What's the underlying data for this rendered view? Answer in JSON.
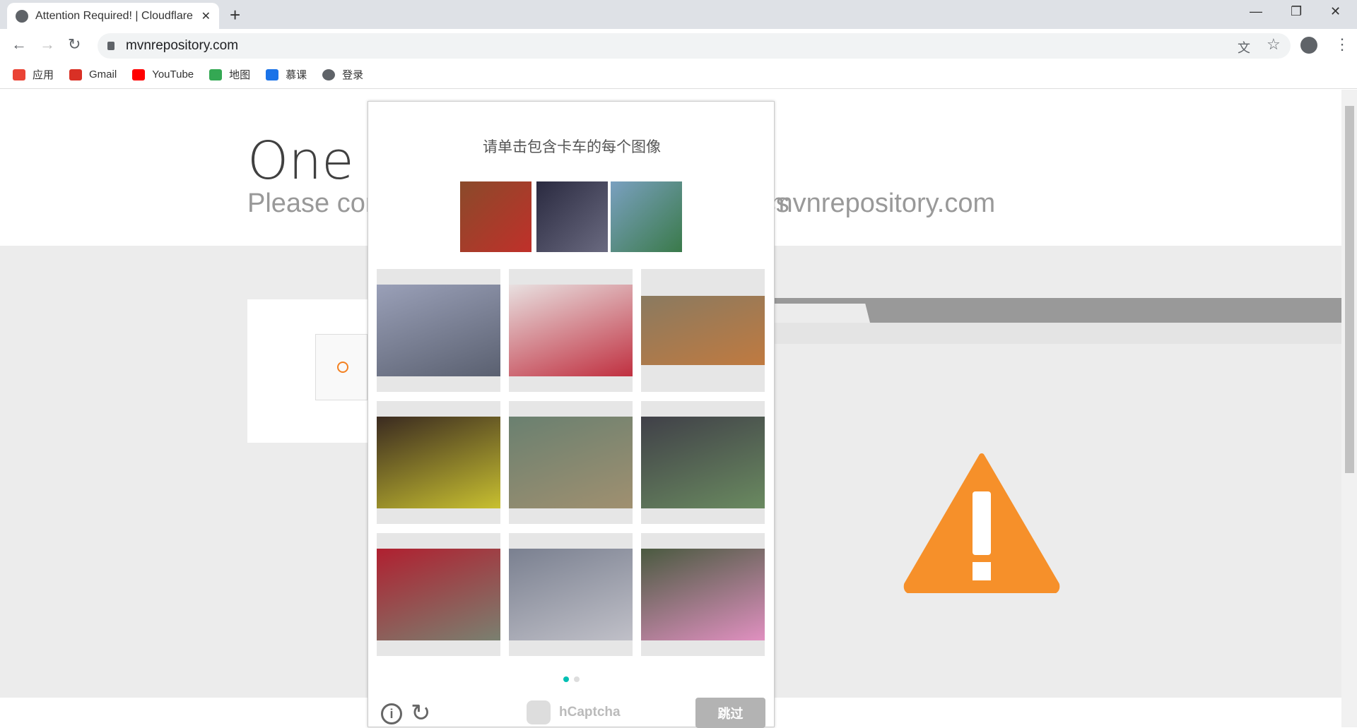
{
  "browser": {
    "tab_title": "Attention Required! | Cloudflare",
    "url": "mvnrepository.com",
    "bookmarks": [
      {
        "label": "应用",
        "color": "#ea4335"
      },
      {
        "label": "Gmail",
        "color": "#d93025"
      },
      {
        "label": "YouTube",
        "color": "#ff0000"
      },
      {
        "label": "地图",
        "color": "#34a853"
      },
      {
        "label": "慕课",
        "color": "#1a73e8"
      },
      {
        "label": "登录",
        "color": "#5f6368"
      }
    ]
  },
  "page": {
    "heading": "One more step",
    "subheading": "Please complete the security check to access",
    "domain": "mvnrepository.com",
    "accent": "#f6902a"
  },
  "captcha": {
    "prompt": "请单击包含卡车的每个图像",
    "brand": "hCaptcha",
    "skip_label": "跳过",
    "page": 1,
    "pages": 2,
    "samples": [
      {
        "name": "fire-truck",
        "c1": "#8a4a2a",
        "c2": "#c0302a"
      },
      {
        "name": "truck-cab",
        "c1": "#2a2a40",
        "c2": "#6a6a80"
      },
      {
        "name": "garbage-truck",
        "c1": "#7aa0c0",
        "c2": "#3a7a4a"
      }
    ],
    "tiles": [
      {
        "name": "truck",
        "c1": "#9aa0b8",
        "c2": "#5a6070"
      },
      {
        "name": "scooters",
        "c1": "#e8e0e0",
        "c2": "#c03040"
      },
      {
        "name": "train",
        "c1": "#8a7a60",
        "c2": "#c07a40"
      },
      {
        "name": "motorbike",
        "c1": "#3a2a20",
        "c2": "#c8c030"
      },
      {
        "name": "canoe",
        "c1": "#6a8070",
        "c2": "#a09070"
      },
      {
        "name": "motorcycle",
        "c1": "#404048",
        "c2": "#6a8a60"
      },
      {
        "name": "red-car",
        "c1": "#b02030",
        "c2": "#7a8070"
      },
      {
        "name": "train-platform",
        "c1": "#7a8090",
        "c2": "#c0c0c8"
      },
      {
        "name": "pedal-boat",
        "c1": "#4a5a40",
        "c2": "#e090c0"
      }
    ]
  }
}
